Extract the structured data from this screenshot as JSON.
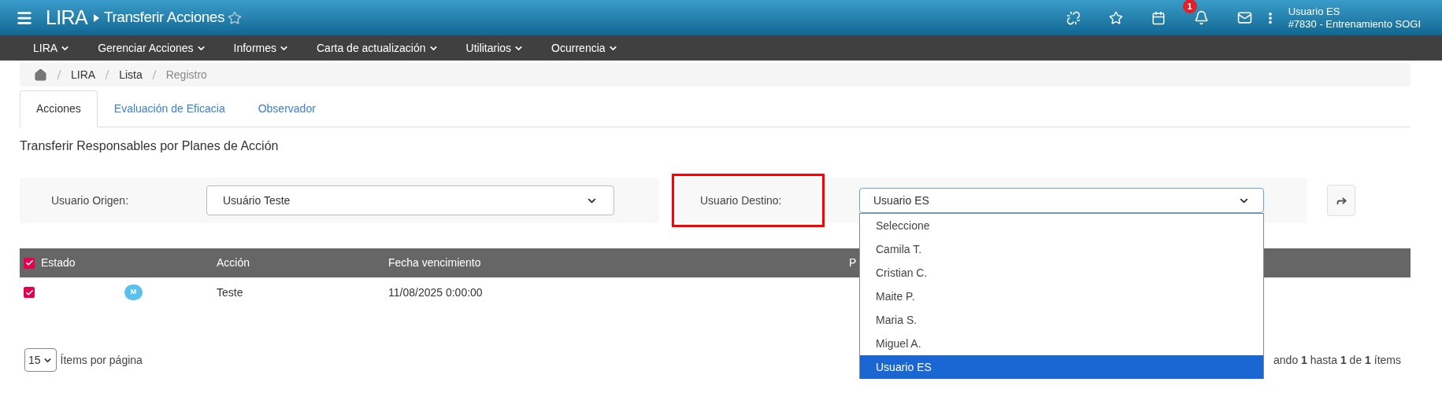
{
  "header": {
    "app": "LIRA",
    "page": "Transferir Acciones",
    "favorite": false,
    "notifications": "1",
    "user": "Usuario ES",
    "environment": "#7830 - Entrenamiento SOGI"
  },
  "menu": [
    "LIRA",
    "Gerenciar Acciones",
    "Informes",
    "Carta de actualización",
    "Utilitarios",
    "Ocurrencia"
  ],
  "breadcrumb": [
    "LIRA",
    "Lista",
    "Registro"
  ],
  "tabs": [
    {
      "label": "Acciones",
      "selected": true
    },
    {
      "label": "Evaluación de Eficacia",
      "selected": false
    },
    {
      "label": "Observador",
      "selected": false
    }
  ],
  "section_title": "Transferir Responsables por Planes de Acción",
  "origin": {
    "label": "Usuario Origen:",
    "value": "Usuário Teste"
  },
  "destination": {
    "label": "Usuario Destino:",
    "value": "Usuario ES",
    "highlighted": true,
    "open": true,
    "options": [
      {
        "label": "Seleccione",
        "selected": false
      },
      {
        "label": "Camila T.",
        "selected": false
      },
      {
        "label": "Cristian C.",
        "selected": false
      },
      {
        "label": "Maite P.",
        "selected": false
      },
      {
        "label": "Maria S.",
        "selected": false
      },
      {
        "label": "Miguel A.",
        "selected": false
      },
      {
        "label": "Usuario ES",
        "selected": true
      }
    ]
  },
  "table": {
    "all_checked": true,
    "columns": [
      "Estado",
      "Acción",
      "Fecha vencimiento",
      "P"
    ],
    "rows": [
      {
        "checked": true,
        "badge": "M",
        "action": "Teste",
        "due": "11/08/2025 0:00:00"
      }
    ]
  },
  "pagination": {
    "page_size": "15",
    "per_page_label": "Ítems por página",
    "summary": "ando **1** hasta **1** de **1** ítems"
  }
}
